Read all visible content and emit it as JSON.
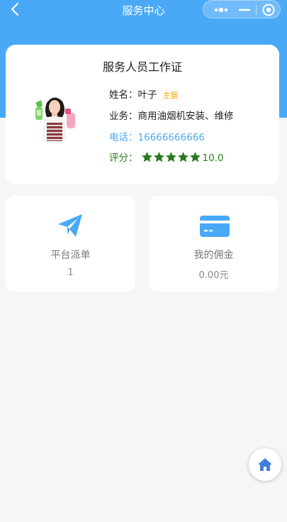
{
  "nav": {
    "title": "服务中心"
  },
  "card": {
    "title": "服务人员工作证",
    "name_label": "姓名：",
    "name": "叶子",
    "role": "主管",
    "business_label": "业务：",
    "business": "商用油烟机安装、维修",
    "phone_label": "电话：",
    "phone": "16666666666",
    "score_label": "评分：",
    "score": "10.0",
    "star_count": 5
  },
  "stats": [
    {
      "label": "平台派单",
      "value": "1",
      "icon": "paper-plane-icon"
    },
    {
      "label": "我的佣金",
      "value": "0.00元",
      "icon": "credit-card-icon"
    }
  ],
  "colors": {
    "header_blue": "#4aa9f7",
    "score_green": "#2a7a1e",
    "badge_orange": "#f0a000",
    "home_icon": "#3f7fd9"
  }
}
